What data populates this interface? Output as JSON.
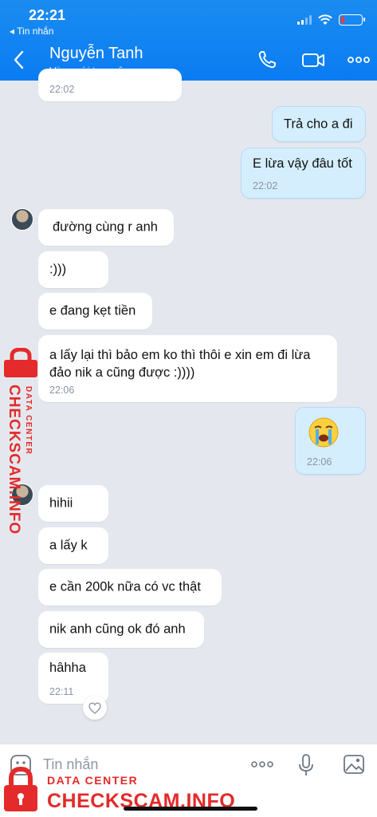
{
  "status_bar": {
    "time": "22:21",
    "back_app": "◂ Tin nhắn"
  },
  "header": {
    "contact_name": "Nguyễn Tanh",
    "contact_status": "Vừa mới truy cập"
  },
  "messages": [
    {
      "from": "contact",
      "text": "",
      "time": "22:02"
    },
    {
      "from": "me",
      "text": "Trả cho a đi",
      "time": ""
    },
    {
      "from": "me",
      "text": "E lừa vậy đâu tốt",
      "time": "22:02"
    },
    {
      "from": "contact",
      "text": "đường cùng r anh",
      "time": ""
    },
    {
      "from": "contact",
      "text": ":)))",
      "time": ""
    },
    {
      "from": "contact",
      "text": "e đang kẹt tiền",
      "time": ""
    },
    {
      "from": "contact",
      "text": "a lấy lại thì bảo em ko thì thôi e xin em đi lừa đảo nik a cũng được :))))",
      "time": "22:06"
    },
    {
      "from": "me",
      "text": "😭",
      "time": "22:06"
    },
    {
      "from": "contact",
      "text": "hihii",
      "time": ""
    },
    {
      "from": "contact",
      "text": "a lấy k",
      "time": ""
    },
    {
      "from": "contact",
      "text": "e cần 200k nữa có vc thật",
      "time": ""
    },
    {
      "from": "contact",
      "text": "nik anh cũng ok đó anh",
      "time": ""
    },
    {
      "from": "contact",
      "text": "hâhha",
      "time": "22:11"
    }
  ],
  "composer": {
    "placeholder": "Tin nhắn"
  },
  "watermark": {
    "small": "DATA CENTER",
    "big": "CHECKSCAM.INFO"
  },
  "colors": {
    "header": "#0a7cf3",
    "my_bubble": "#d5eefe",
    "background": "#e4e8ee",
    "watermark": "#e42a2a"
  }
}
